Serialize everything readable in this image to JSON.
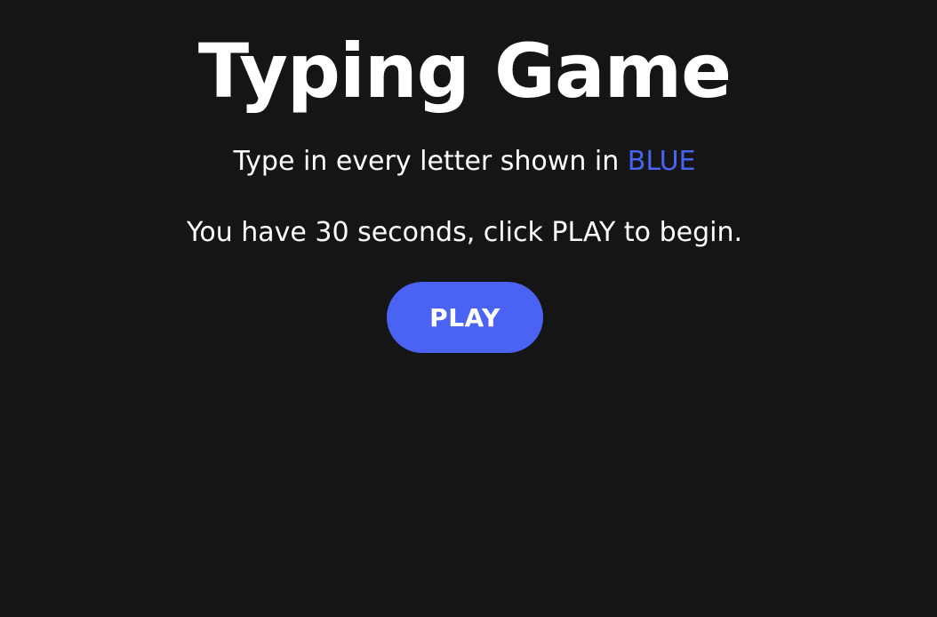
{
  "game": {
    "title": "Typing Game",
    "instruction_prefix": "Type in every letter shown in",
    "instruction_color_word": "BLUE",
    "timer_text": "You have 30 seconds, click PLAY to begin.",
    "play_label": "PLAY"
  },
  "colors": {
    "background": "#151516",
    "text": "#ffffff",
    "accent": "#4a63f3"
  }
}
